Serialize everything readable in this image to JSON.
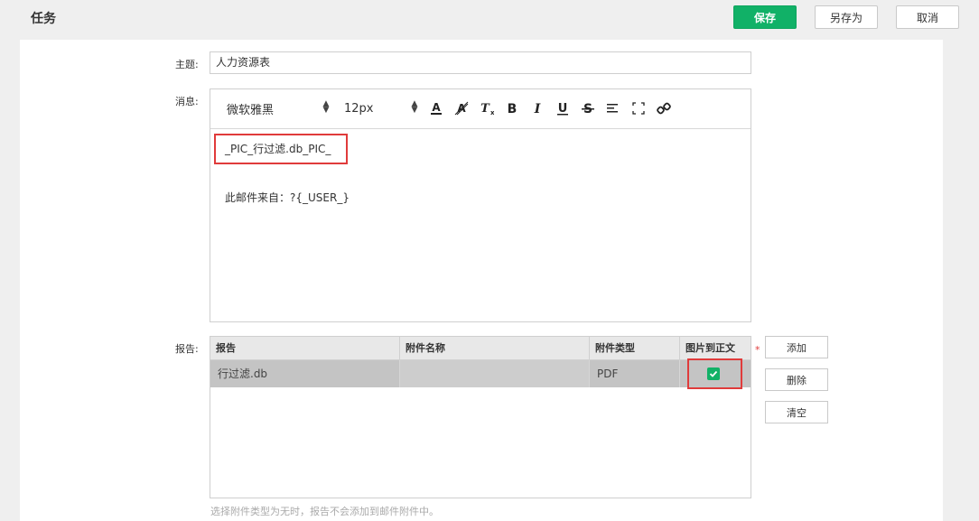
{
  "header": {
    "title": "任务",
    "save_label": "保存",
    "save_as_label": "另存为",
    "cancel_label": "取消"
  },
  "form": {
    "subject_label": "主题:",
    "subject_value": "人力资源表",
    "message_label": "消息:",
    "report_label": "报告:"
  },
  "editor": {
    "font_family": "微软雅黑",
    "font_size": "12px",
    "toolbar_icons": [
      "font-color-icon",
      "highlight-icon",
      "clear-format-icon",
      "bold-icon",
      "italic-icon",
      "underline-icon",
      "strikethrough-icon",
      "align-icon",
      "fullscreen-icon",
      "link-icon"
    ],
    "line1": "_PIC_行过滤.db_PIC_",
    "line2": "此邮件来自：?{_USER_}"
  },
  "report_table": {
    "columns": [
      "报告",
      "附件名称",
      "附件类型",
      "图片到正文"
    ],
    "rows": [
      {
        "report": "行过滤.db",
        "attachment_name": "",
        "attachment_type": "PDF",
        "pic_to_body": true
      }
    ],
    "required_mark": "*"
  },
  "side_buttons": {
    "add": "添加",
    "delete": "删除",
    "clear": "清空"
  },
  "hint": "选择附件类型为无时，报告不会添加到邮件附件中。",
  "colors": {
    "primary": "#11b167",
    "highlight_box": "#e03b3b",
    "selected_row": "#c4c4c4"
  }
}
